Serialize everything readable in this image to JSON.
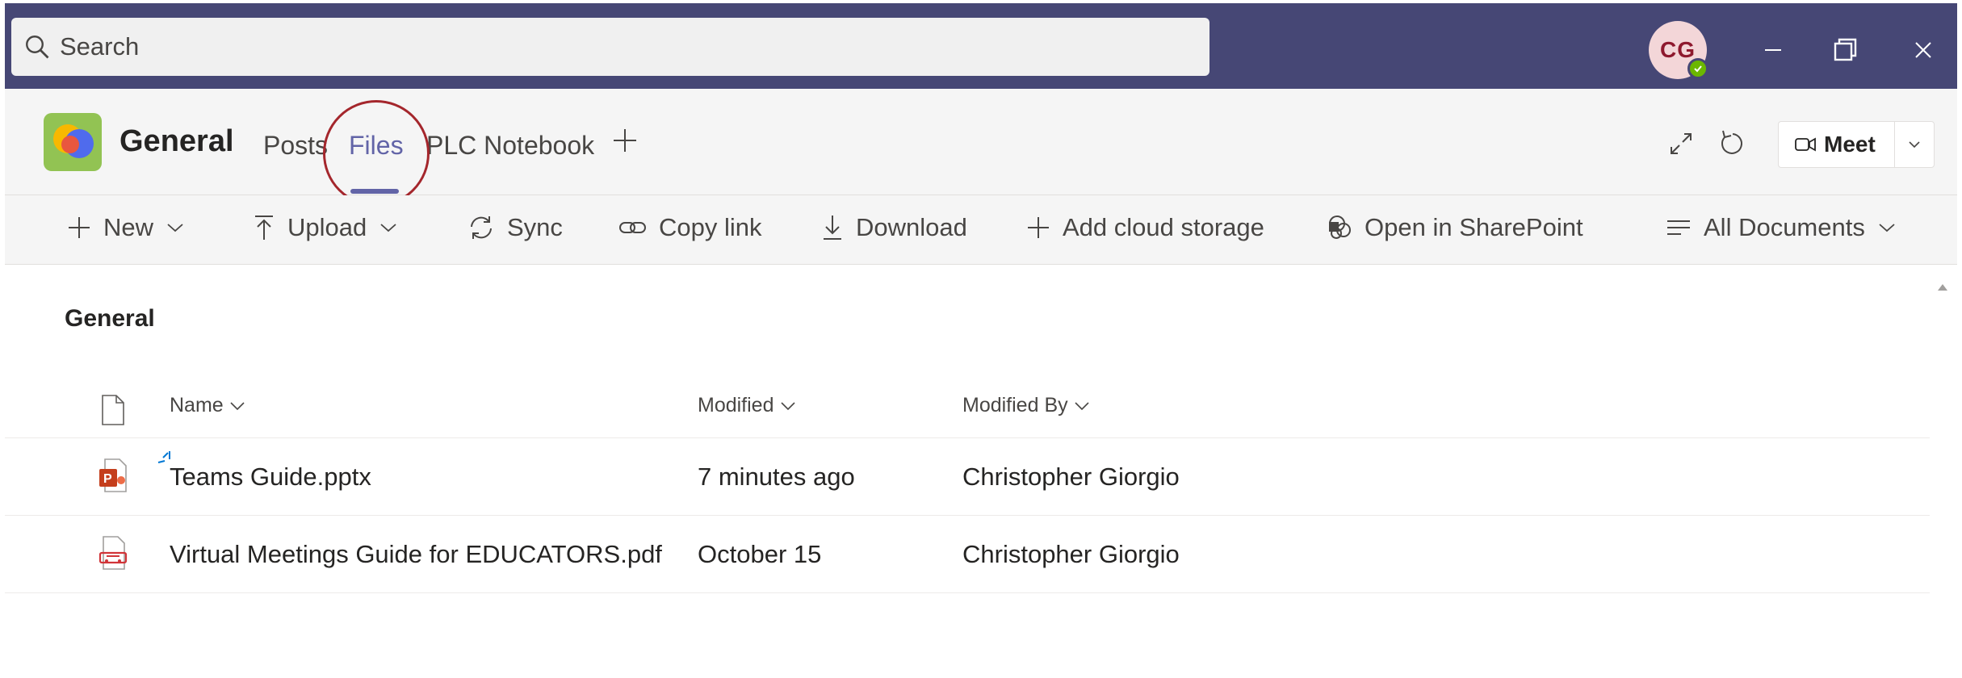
{
  "titlebar": {
    "search_placeholder": "Search",
    "avatar_initials": "CG",
    "presence_status": "available",
    "window_controls": [
      "minimize-icon",
      "restore-icon",
      "close-icon"
    ]
  },
  "channel": {
    "name": "General",
    "tabs": [
      {
        "label": "Posts",
        "active": false
      },
      {
        "label": "Files",
        "active": true
      },
      {
        "label": "PLC Notebook",
        "active": false
      }
    ],
    "add_tab_icon": "plus-icon",
    "meet_label": "Meet"
  },
  "commands": {
    "new": "New",
    "upload": "Upload",
    "sync": "Sync",
    "copy_link": "Copy link",
    "download": "Download",
    "add_cloud_storage": "Add cloud storage",
    "open_in_sharepoint": "Open in SharePoint",
    "view": "All Documents"
  },
  "library": {
    "title": "General",
    "columns": {
      "name": "Name",
      "modified": "Modified",
      "modified_by": "Modified By"
    },
    "files": [
      {
        "name": "Teams Guide.pptx",
        "modified": "7 minutes ago",
        "modified_by": "Christopher Giorgio",
        "type": "pptx",
        "is_new": true
      },
      {
        "name": "Virtual Meetings Guide for EDUCATORS.pdf",
        "modified": "October 15",
        "modified_by": "Christopher Giorgio",
        "type": "pdf",
        "is_new": false
      }
    ]
  },
  "colors": {
    "titlebar": "#464775",
    "accent": "#6264a7",
    "annotation_circle": "#a4262c",
    "presence": "#6bb700"
  }
}
